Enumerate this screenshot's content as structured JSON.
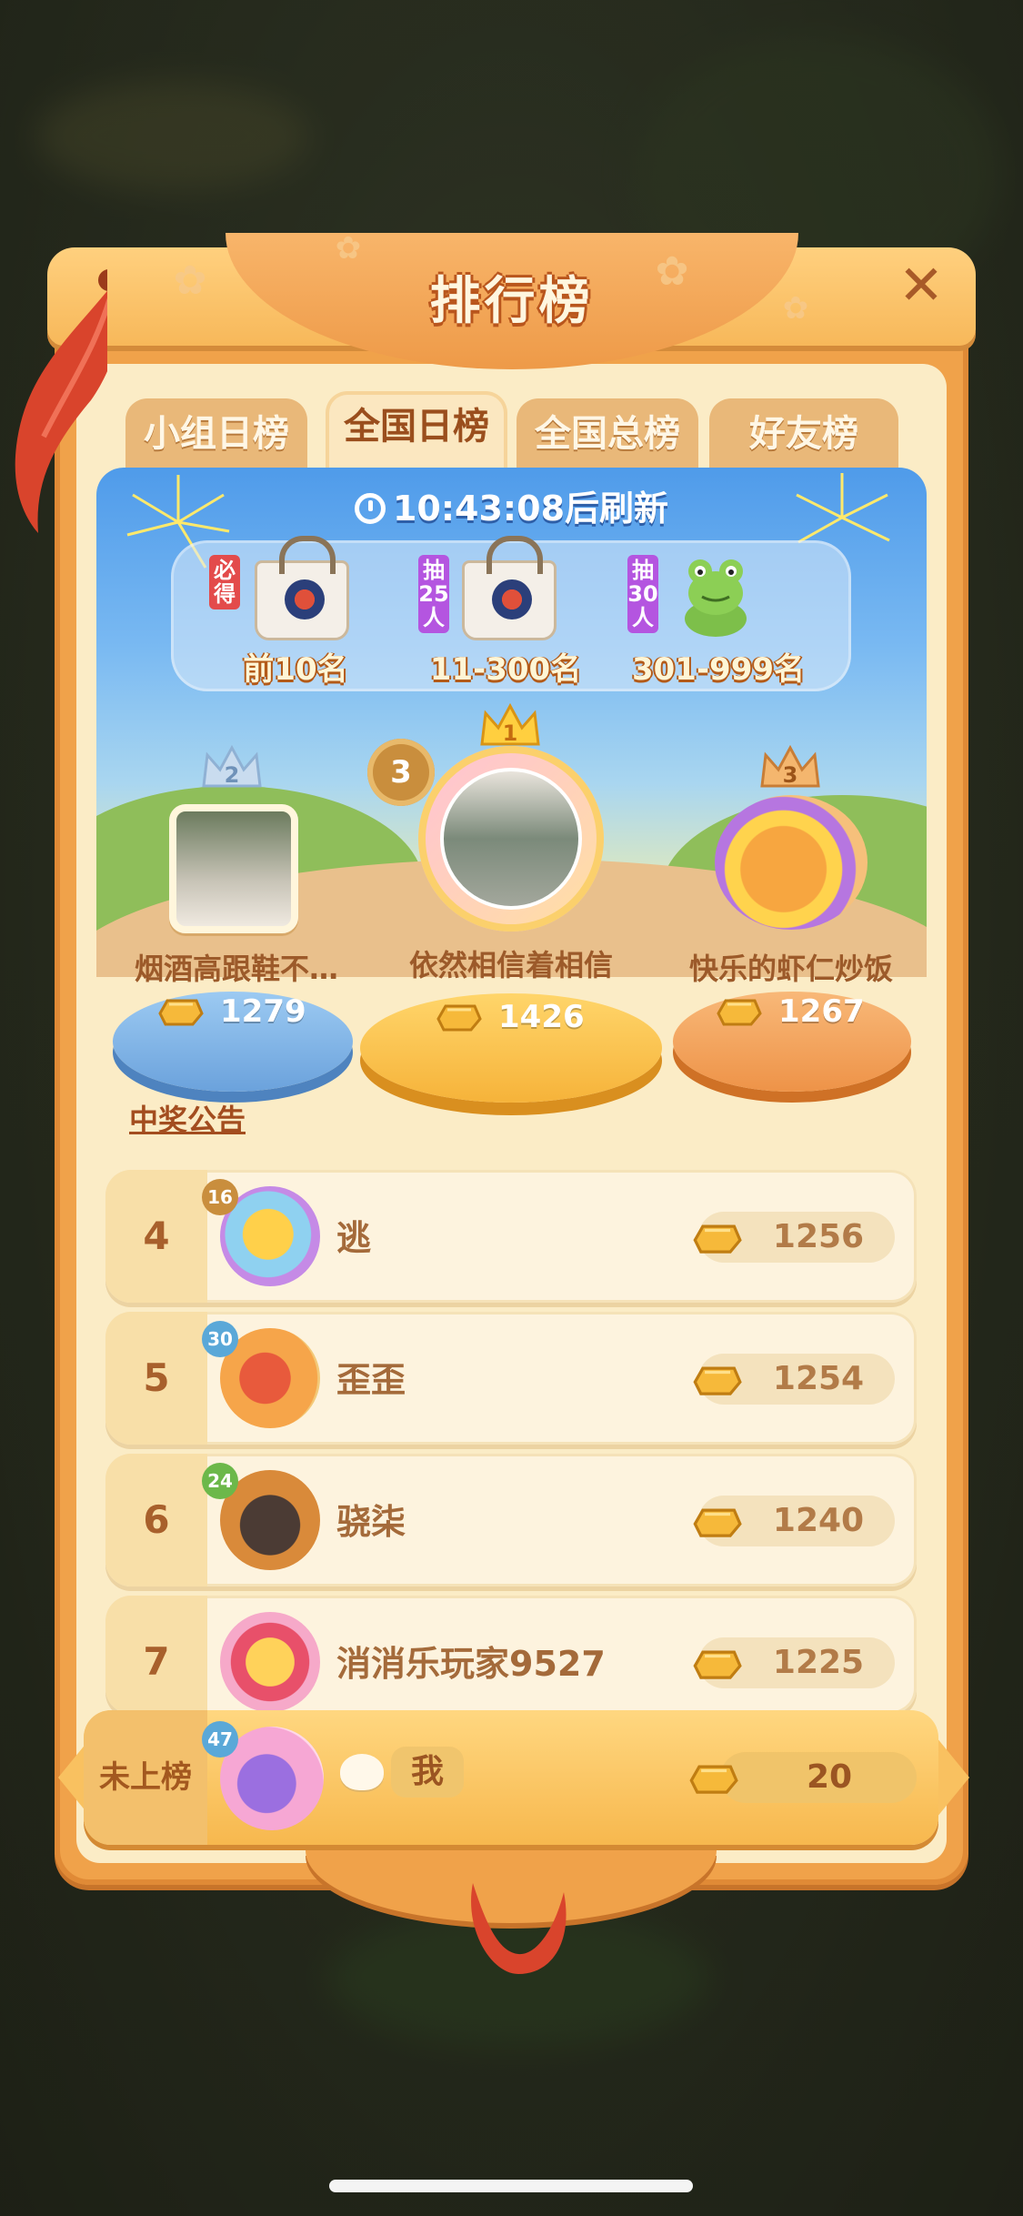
{
  "header": {
    "title": "排行榜",
    "close_icon": "close-icon"
  },
  "tabs": [
    {
      "label": "小组日榜",
      "active": false
    },
    {
      "label": "全国日榜",
      "active": true
    },
    {
      "label": "全国总榜",
      "active": false
    },
    {
      "label": "好友榜",
      "active": false
    }
  ],
  "refresh": {
    "time": "10:43:08",
    "suffix": "后刷新",
    "icon": "clock-icon"
  },
  "prizes": [
    {
      "tag": "必得",
      "tag_color": "#e34b4b",
      "range": "前10名",
      "icon": "tote-bag-icon"
    },
    {
      "tag": "抽25人",
      "tag_color": "#b455e0",
      "range": "11-300名",
      "icon": "tote-bag-icon"
    },
    {
      "tag": "抽30人",
      "tag_color": "#b455e0",
      "range": "301-999名",
      "icon": "frog-plush-icon"
    }
  ],
  "podium": [
    {
      "place": "2",
      "name": "烟酒高跟鞋不…",
      "score": "1279",
      "color": "#8fc0ee"
    },
    {
      "place": "1",
      "name": "依然相信着相信",
      "score": "1426",
      "level": "3",
      "color": "#ffc64a"
    },
    {
      "place": "3",
      "name": "快乐的虾仁炒饭",
      "score": "1267",
      "color": "#f2a55c"
    }
  ],
  "announcement": "中奖公告",
  "rows": [
    {
      "rank": "4",
      "level": "16",
      "name": "逃",
      "score": "1256"
    },
    {
      "rank": "5",
      "level": "30",
      "name": "歪歪",
      "score": "1254"
    },
    {
      "rank": "6",
      "level": "24",
      "name": "骁柒",
      "score": "1240"
    },
    {
      "rank": "7",
      "level": "",
      "name": "消消乐玩家9527",
      "score": "1225"
    }
  ],
  "me": {
    "status": "未上榜",
    "level": "47",
    "name": "我",
    "score": "20"
  },
  "colors": {
    "panel": "#f0a24a",
    "accent": "#a34d1f",
    "gold": "#f6b93a"
  }
}
